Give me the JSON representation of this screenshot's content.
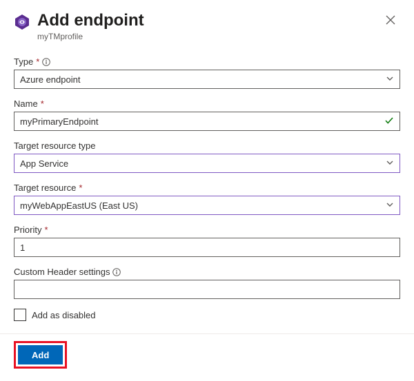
{
  "header": {
    "title": "Add endpoint",
    "subtitle": "myTMprofile"
  },
  "fields": {
    "type": {
      "label": "Type",
      "required": true,
      "info": true,
      "value": "Azure endpoint",
      "kind": "dropdown",
      "highlight": false,
      "valid": false
    },
    "name": {
      "label": "Name",
      "required": true,
      "info": false,
      "value": "myPrimaryEndpoint",
      "kind": "text",
      "highlight": false,
      "valid": true
    },
    "trtype": {
      "label": "Target resource type",
      "required": false,
      "info": false,
      "value": "App Service",
      "kind": "dropdown",
      "highlight": true,
      "valid": false
    },
    "tres": {
      "label": "Target resource",
      "required": true,
      "info": false,
      "value": "myWebAppEastUS (East US)",
      "kind": "dropdown",
      "highlight": true,
      "valid": false
    },
    "prio": {
      "label": "Priority",
      "required": true,
      "info": false,
      "value": "1",
      "kind": "text",
      "highlight": false,
      "valid": false
    },
    "headers": {
      "label": "Custom Header settings",
      "required": false,
      "info": true,
      "value": "",
      "kind": "text",
      "highlight": false,
      "valid": false
    }
  },
  "disabledCheckbox": {
    "label": "Add as disabled",
    "checked": false
  },
  "footer": {
    "addLabel": "Add"
  }
}
